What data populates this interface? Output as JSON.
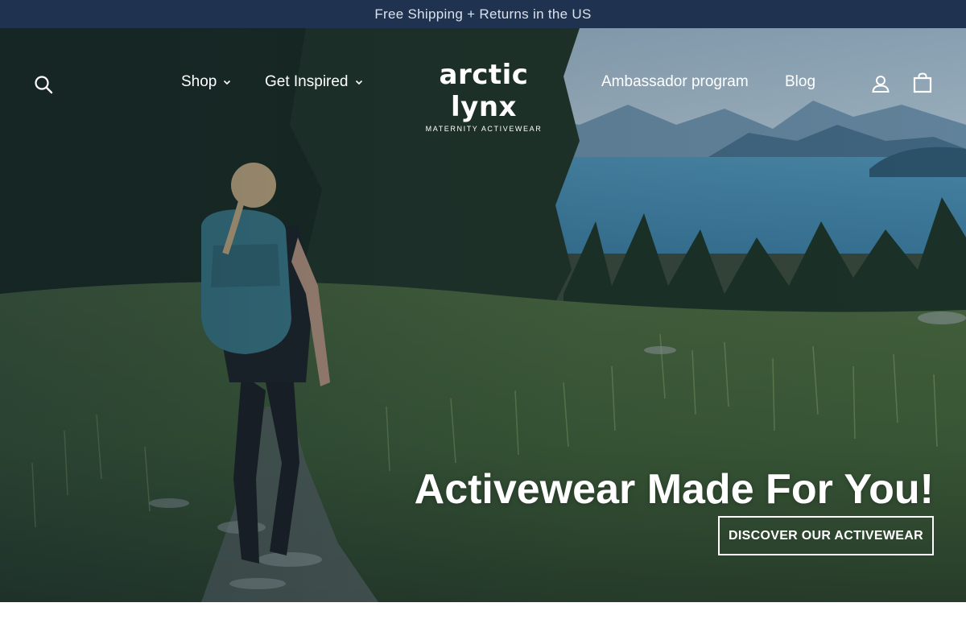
{
  "announcement": {
    "text": "Free Shipping + Returns in the US"
  },
  "header": {
    "search_icon": "search-icon",
    "nav_left": [
      {
        "label": "Shop",
        "has_dropdown": true
      },
      {
        "label": "Get Inspired",
        "has_dropdown": true
      }
    ],
    "logo": {
      "wordmark": "arctic lynx",
      "tagline": "MATERNITY ACTIVEWEAR"
    },
    "nav_right": [
      {
        "label": "Ambassador program"
      },
      {
        "label": "Blog"
      }
    ],
    "account_icon": "user-icon",
    "cart_icon": "bag-icon"
  },
  "hero": {
    "title": "Activewear Made For You!",
    "cta_label": "DISCOVER OUR ACTIVEWEAR"
  },
  "colors": {
    "announcement_bg": "#1f3250",
    "text_on_dark": "#ffffff"
  }
}
